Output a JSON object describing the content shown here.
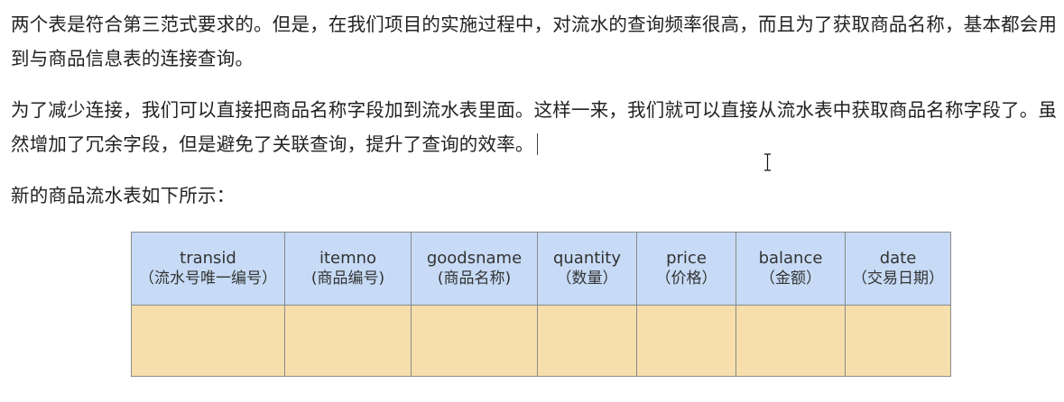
{
  "article": {
    "paragraph_1": "两个表是符合第三范式要求的。但是，在我们项目的实施过程中，对流水的查询频率很高，而且为了获取商品名称，基本都会用到与商品信息表的连接查询。",
    "paragraph_2": "为了减少连接，我们可以直接把商品名称字段加到流水表里面。这样一来，我们就可以直接从流水表中获取商品名称字段了。虽然增加了冗余字段，但是避免了关联查询，提升了查询的效率。",
    "paragraph_3": "新的商品流水表如下所示："
  },
  "table_diagram": {
    "header_color": "#c7dbf6",
    "body_color": "#f6dfad",
    "columns": [
      {
        "en": "transid",
        "cn": "（流水号唯一编号）"
      },
      {
        "en": "itemno",
        "cn": "(商品编号)"
      },
      {
        "en": "goodsname",
        "cn": "(商品名称)"
      },
      {
        "en": "quantity",
        "cn": "（数量）"
      },
      {
        "en": "price",
        "cn": "（价格）"
      },
      {
        "en": "balance",
        "cn": "（金额）"
      },
      {
        "en": "date",
        "cn": "（交易日期）"
      }
    ]
  }
}
